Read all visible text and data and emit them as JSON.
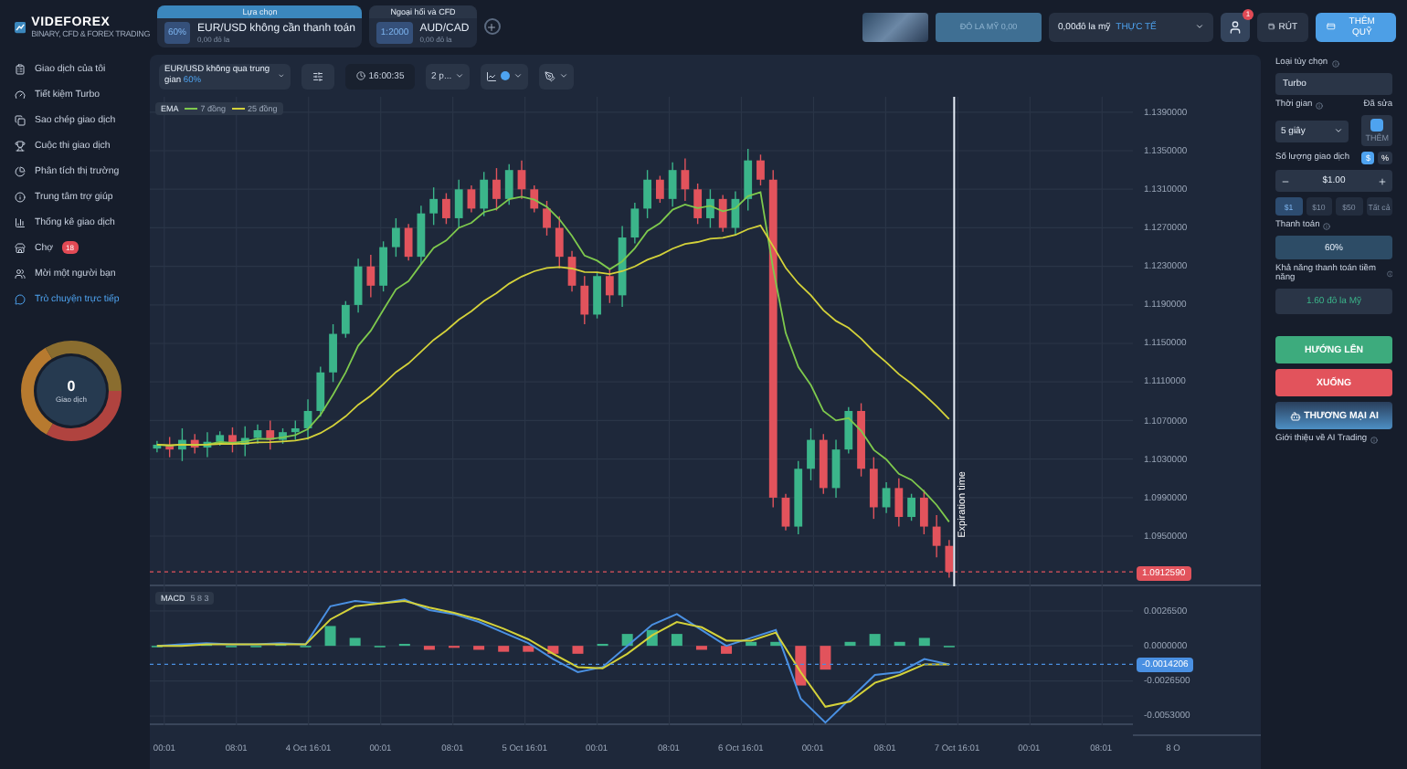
{
  "logo": {
    "name": "VIDEFOREX",
    "tagline": "BINARY, CFD & FOREX TRADING"
  },
  "asset_tabs": [
    {
      "header": "Lựa chọn",
      "badge": "60%",
      "name": "EUR/USD không cần thanh toán",
      "balance": "0,00 đô la",
      "selected": true
    },
    {
      "header": "Ngoại hối và CFD",
      "badge": "1:2000",
      "name": "AUD/CAD",
      "balance": "0,00 đô la",
      "selected": false
    }
  ],
  "header_actions": {
    "bonus_button": "ĐÔ LA MỸ 0,00",
    "account": {
      "balance": "0,00đô la mỹ",
      "type": "THỰC TẾ"
    },
    "notification_count": "1",
    "withdraw": "RÚT",
    "deposit": "THÊM QUỸ"
  },
  "sidebar": {
    "items": [
      {
        "label": "Giao dịch của tôi",
        "selected": false
      },
      {
        "label": "Tiết kiệm Turbo",
        "selected": false
      },
      {
        "label": "Sao chép giao dịch",
        "selected": false
      },
      {
        "label": "Cuộc thi giao dịch",
        "selected": false
      },
      {
        "label": "Phân tích thị trường",
        "selected": false
      },
      {
        "label": "Trung tâm trợ giúp",
        "selected": false
      },
      {
        "label": "Thống kê giao dịch",
        "selected": false
      },
      {
        "label": "Chợ",
        "badge": "18",
        "selected": false
      },
      {
        "label": "Mời một người bạn",
        "selected": false
      },
      {
        "label": "Trò chuyện trực tiếp",
        "selected": true
      }
    ],
    "trades": {
      "count": "0",
      "label": "Giao dịch"
    }
  },
  "chart": {
    "asset": {
      "name": "EUR/USD không qua trung gian",
      "payout": "60%"
    },
    "time": "16:00:35",
    "interval": "2 p...",
    "ema_legend": {
      "title": "EMA",
      "lines": [
        {
          "label": "7 đồng",
          "color": "#7ec94d"
        },
        {
          "label": "25 đồng",
          "color": "#d4d23a"
        }
      ]
    },
    "expiration_label": "Expiration time",
    "current_price": "1.0912590",
    "price_axis": [
      "1.1390000",
      "1.1350000",
      "1.1310000",
      "1.1270000",
      "1.1230000",
      "1.1190000",
      "1.1150000",
      "1.1110000",
      "1.1070000",
      "1.1030000",
      "1.0990000",
      "1.0950000"
    ]
  },
  "macd": {
    "title": "MACD",
    "params": "5 8 3",
    "current_value": "-0.0014206",
    "axis": [
      "0.0026500",
      "0.0000000",
      "-0.0026500",
      "-0.0053000"
    ]
  },
  "time_axis": [
    "00:01",
    "08:01",
    "4 Oct 16:01",
    "00:01",
    "08:01",
    "5 Oct 16:01",
    "00:01",
    "08:01",
    "6 Oct 16:01",
    "00:01",
    "08:01",
    "7 Oct 16:01",
    "00:01",
    "08:01",
    "8 O"
  ],
  "trade_panel": {
    "option_type_label": "Loại tùy chọn",
    "option_type": "Turbo",
    "time_label": "Thời gian",
    "fixed_label": "Đã sửa",
    "duration": "5 giây",
    "fixed_toggle": {
      "on": true,
      "label": "THÊM"
    },
    "amount_label": "Số lượng giao dịch",
    "amount_units": [
      {
        "label": "$",
        "selected": true
      },
      {
        "label": "%",
        "selected": false
      }
    ],
    "amount": "$1.00",
    "presets": [
      {
        "label": "$1",
        "selected": true
      },
      {
        "label": "$10",
        "selected": false
      },
      {
        "label": "$50",
        "selected": false
      },
      {
        "label": "Tất cả",
        "selected": false
      }
    ],
    "payout_label": "Thanh toán",
    "payout": "60%",
    "potential_label": "Khả năng thanh toán tiềm năng",
    "potential": "1.60 đô la Mỹ",
    "buttons": [
      {
        "kind": "up",
        "label": "HƯỚNG LÊN"
      },
      {
        "kind": "down",
        "label": "XUỐNG"
      },
      {
        "kind": "ai",
        "label": "THƯƠNG MẠI AI"
      }
    ],
    "ai_intro": "Giới thiệu về AI Trading"
  }
}
